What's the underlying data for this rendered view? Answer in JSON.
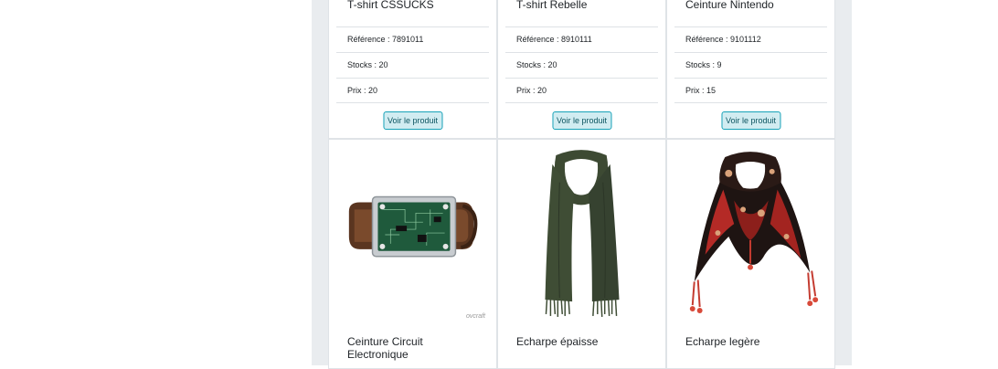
{
  "products_top": [
    {
      "name": "T-shirt CSSUCKS",
      "reference": "Référence : 7891011",
      "stocks": "Stocks : 20",
      "price": "Prix : 20",
      "button": "Voir le produit"
    },
    {
      "name": "T-shirt Rebelle",
      "reference": "Référence : 8910111",
      "stocks": "Stocks : 20",
      "price": "Prix : 20",
      "button": "Voir le produit"
    },
    {
      "name": "Ceinture Nintendo",
      "reference": "Référence : 9101112",
      "stocks": "Stocks : 9",
      "price": "Prix : 15",
      "button": "Voir le produit"
    }
  ],
  "products_bottom": [
    {
      "name": "Ceinture Circuit Electronique",
      "image": "circuit-belt-image",
      "watermark": "ovcraft"
    },
    {
      "name": "Echarpe épaisse",
      "image": "green-scarf-image"
    },
    {
      "name": "Echarpe legère",
      "image": "red-floral-scarf-image"
    }
  ],
  "colors": {
    "button_bg": "#d1ecf1",
    "button_border": "#17a2b8",
    "button_text": "#0c5460",
    "page_bg": "#e9ecef"
  }
}
